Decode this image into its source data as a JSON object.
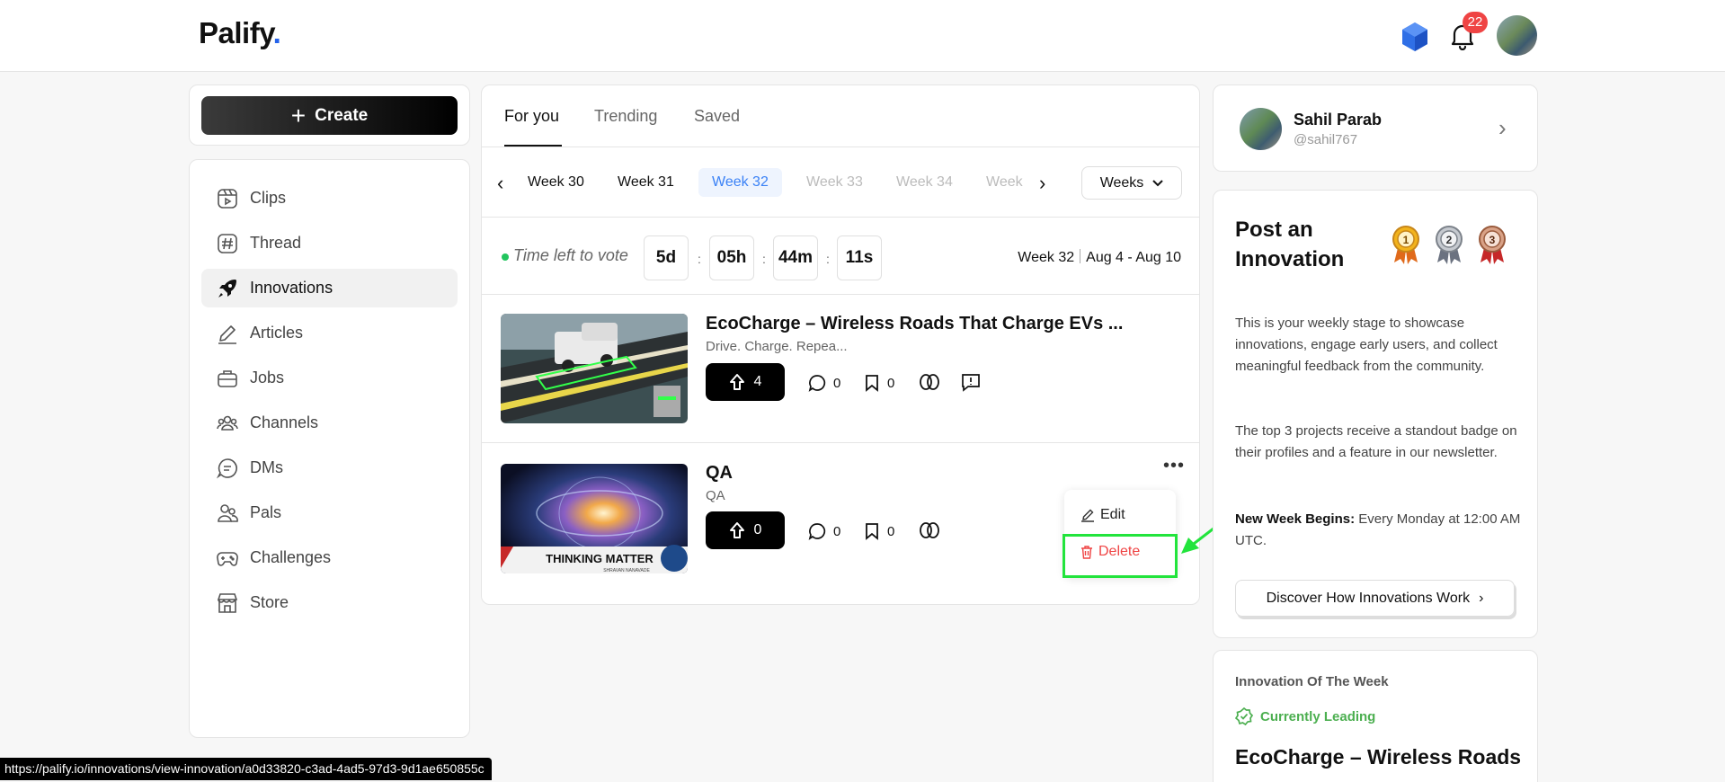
{
  "brand": {
    "name": "Palify",
    "dot": "."
  },
  "header": {
    "notification_count": "22"
  },
  "sidebar": {
    "create_label": "Create",
    "items": [
      {
        "label": "Clips",
        "icon": "clips-icon"
      },
      {
        "label": "Thread",
        "icon": "hash-icon"
      },
      {
        "label": "Innovations",
        "icon": "rocket-icon"
      },
      {
        "label": "Articles",
        "icon": "pencil-icon"
      },
      {
        "label": "Jobs",
        "icon": "briefcase-icon"
      },
      {
        "label": "Channels",
        "icon": "users-icon"
      },
      {
        "label": "DMs",
        "icon": "chat-icon"
      },
      {
        "label": "Pals",
        "icon": "pals-icon"
      },
      {
        "label": "Challenges",
        "icon": "gamepad-icon"
      },
      {
        "label": "Store",
        "icon": "store-icon"
      }
    ],
    "active": "Innovations"
  },
  "feed": {
    "tabs": [
      "For you",
      "Trending",
      "Saved"
    ],
    "active_tab": "For you",
    "weeks": [
      "Week 30",
      "Week 31",
      "Week 32",
      "Week 33",
      "Week 34",
      "Week"
    ],
    "selected_week": "Week 32",
    "weeks_dropdown": "Weeks",
    "vote": {
      "label": "Time left to vote",
      "days": "5d",
      "hours": "05h",
      "minutes": "44m",
      "seconds": "11s",
      "sep": ":"
    },
    "week_label": "Week 32",
    "date_range": "Aug 4 - Aug 10",
    "posts": [
      {
        "title": "EcoCharge – Wireless Roads That Charge EVs ...",
        "subtitle": "Drive. Charge. Repea...",
        "upvotes": "4",
        "comments": "0",
        "saves": "0"
      },
      {
        "title": "QA",
        "subtitle": "QA",
        "upvotes": "0",
        "comments": "0",
        "saves": "0",
        "thumb_caption": "THINKING MATTER",
        "thumb_sub": "SHRAVAN NANAVADE"
      }
    ],
    "menu": {
      "edit": "Edit",
      "delete": "Delete"
    }
  },
  "profile": {
    "name": "Sahil Parab",
    "handle": "@sahil767"
  },
  "info": {
    "title": "Post an Innovation",
    "medals": [
      "1",
      "2",
      "3"
    ],
    "p1": "This is your weekly stage to showcase innovations, engage early users, and collect meaningful feedback from the community.",
    "p2": "The top 3 projects receive a standout badge on their profiles and a feature in our newsletter.",
    "new_week_label": "New Week Begins:",
    "new_week_text": " Every Monday at 12:00 AM UTC.",
    "discover": "Discover How Innovations Work",
    "discover_chevron": "›"
  },
  "iow": {
    "label": "Innovation Of The Week",
    "leading": "Currently Leading",
    "title": "EcoCharge – Wireless Roads"
  },
  "statusbar": {
    "url": "https://palify.io/innovations/view-innovation/a0d33820-c3ad-4ad5-97d3-9d1ae650855c"
  },
  "colors": {
    "accent": "#3b82f6",
    "danger": "#ef4444",
    "success": "#22c55e",
    "highlight": "#22e43c"
  }
}
